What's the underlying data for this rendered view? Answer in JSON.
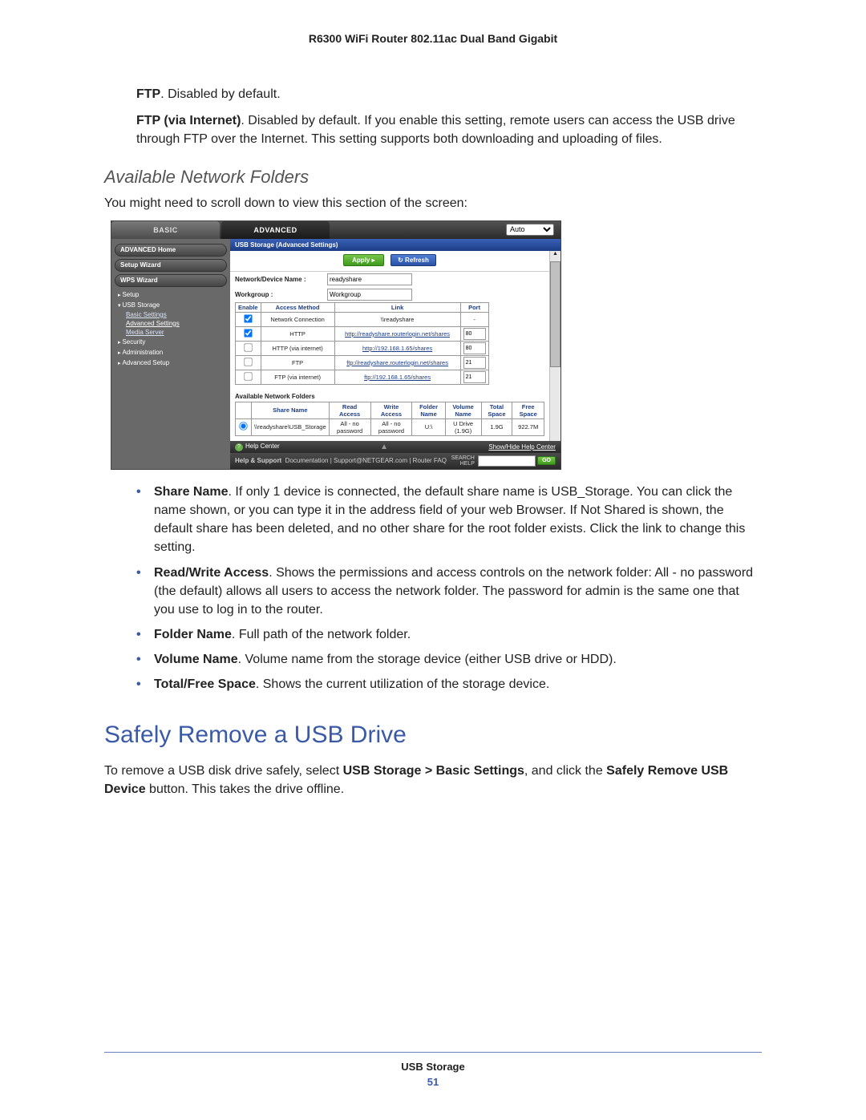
{
  "doc_header": "R6300 WiFi Router 802.11ac Dual Band Gigabit",
  "intro": {
    "ftp_label": "FTP",
    "ftp_text": ". Disabled by default.",
    "ftp_inet_label": "FTP (via Internet)",
    "ftp_inet_text": ". Disabled by default. If you enable this setting, remote users can access the USB drive through FTP over the Internet. This setting supports both downloading and uploading of files."
  },
  "subheading": "Available Network Folders",
  "sub_text": "You might need to scroll down to view this section of the screen:",
  "screenshot": {
    "tabs": {
      "basic": "BASIC",
      "advanced": "ADVANCED",
      "auto_label": "Auto"
    },
    "sidebar": {
      "pills": [
        "ADVANCED Home",
        "Setup Wizard",
        "WPS Wizard"
      ],
      "rows": [
        {
          "label": "Setup",
          "open": false
        },
        {
          "label": "USB Storage",
          "open": true,
          "subs": [
            {
              "label": "Basic Settings",
              "sel": false
            },
            {
              "label": "Advanced Settings",
              "sel": true
            },
            {
              "label": "Media Server",
              "sel": false
            }
          ]
        },
        {
          "label": "Security",
          "open": false
        },
        {
          "label": "Administration",
          "open": false
        },
        {
          "label": "Advanced Setup",
          "open": false
        }
      ]
    },
    "crumb": "USB Storage (Advanced Settings)",
    "buttons": {
      "apply": "Apply ▸",
      "refresh": "↻ Refresh"
    },
    "kv": [
      {
        "k": "Network/Device Name :",
        "v": "readyshare"
      },
      {
        "k": "Workgroup :",
        "v": "Workgroup"
      }
    ],
    "access_table": {
      "headers": [
        "Enable",
        "Access Method",
        "Link",
        "Port"
      ],
      "rows": [
        {
          "enabled": true,
          "method": "Network Connection",
          "link": "\\\\readyshare",
          "port": "-"
        },
        {
          "enabled": true,
          "method": "HTTP",
          "link": "http://readyshare.routerlogin.net/shares",
          "port": "80"
        },
        {
          "enabled": false,
          "method": "HTTP (via internet)",
          "link": "http://192.168.1.65/shares",
          "port": "80"
        },
        {
          "enabled": false,
          "method": "FTP",
          "link": "ftp://readyshare.routerlogin.net/shares",
          "port": "21"
        },
        {
          "enabled": false,
          "method": "FTP (via internet)",
          "link": "ftp://192.168.1.65/shares",
          "port": "21"
        }
      ]
    },
    "folders_title": "Available Network Folders",
    "folders_table": {
      "headers": [
        "",
        "Share Name",
        "Read Access",
        "Write Access",
        "Folder Name",
        "Volume Name",
        "Total Space",
        "Free Space"
      ],
      "row": {
        "share": "\\\\readyshare\\USB_Storage",
        "read": "All - no password",
        "write": "All - no password",
        "folder": "U:\\",
        "volume": "U Drive (1.9G)",
        "total": "1.9G",
        "free": "922.7M"
      }
    },
    "help_center": "Help Center",
    "show_hide": "Show/Hide Help Center",
    "support": {
      "label": "Help & Support",
      "links": "Documentation  |  Support@NETGEAR.com  |  Router FAQ",
      "search": "SEARCH",
      "help": "HELP",
      "go": "GO"
    }
  },
  "bullets": [
    {
      "b": "Share Name",
      "t": ". If only 1 device is connected, the default share name is USB_Storage. You can click the name shown, or you can type it in the address field of your web Browser. If Not Shared is shown, the default share has been deleted, and no other share for the root folder exists. Click the link to change this setting."
    },
    {
      "b": "Read/Write Access",
      "t": ". Shows the permissions and access controls on the network folder: All - no password (the default) allows all users to access the network folder. The password for admin is the same one that you use to log in to the router."
    },
    {
      "b": "Folder Name",
      "t": ". Full path of the network folder."
    },
    {
      "b": "Volume Name",
      "t": ". Volume name from the storage device (either USB drive or HDD)."
    },
    {
      "b": "Total/Free Space",
      "t": ". Shows the current utilization of the storage device."
    }
  ],
  "h1": "Safely Remove a USB Drive",
  "h1_text_pre": "To remove a USB disk drive safely, select ",
  "h1_text_b1": "USB Storage > Basic Settings",
  "h1_text_mid": ", and click the ",
  "h1_text_b2": "Safely Remove USB Device",
  "h1_text_post": " button. This takes the drive offline.",
  "footer": {
    "title": "USB Storage",
    "page": "51"
  }
}
